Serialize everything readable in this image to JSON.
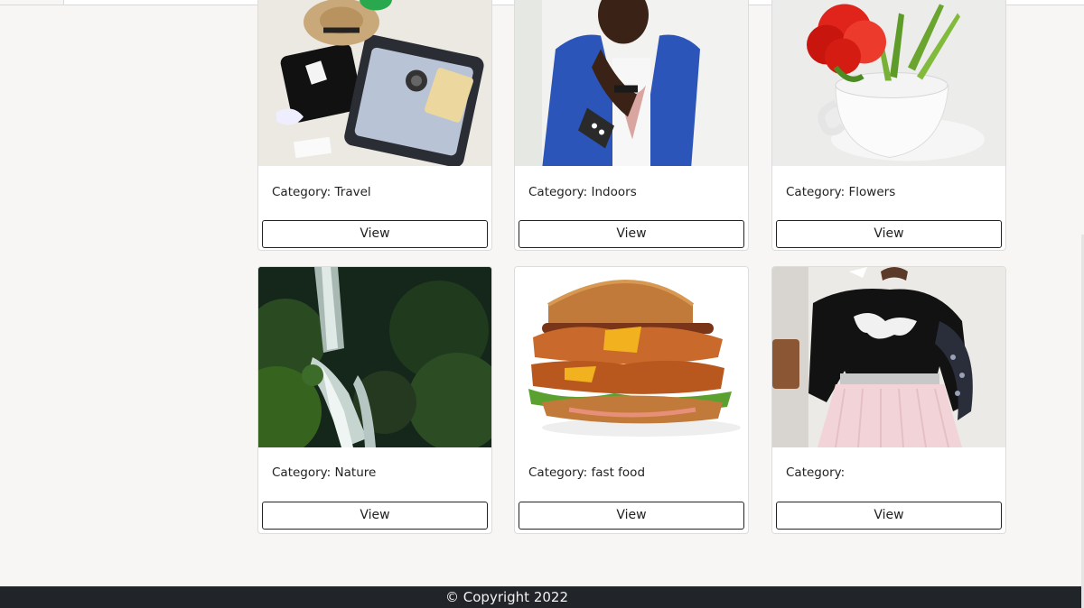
{
  "gallery": {
    "cards": [
      {
        "category_label": "Category: Travel",
        "view_label": "View",
        "image": "travel-suitcase-photo"
      },
      {
        "category_label": "Category: Indoors",
        "view_label": "View",
        "image": "woman-blue-blazer-photo"
      },
      {
        "category_label": "Category: Flowers",
        "view_label": "View",
        "image": "red-tulip-in-cup-photo"
      },
      {
        "category_label": "Category: Nature",
        "view_label": "View",
        "image": "waterfall-forest-photo"
      },
      {
        "category_label": "Category: fast food",
        "view_label": "View",
        "image": "chicken-burger-photo"
      },
      {
        "category_label": "Category:",
        "view_label": "View",
        "image": "pink-skirt-outfit-photo"
      }
    ]
  },
  "footer": {
    "copyright": "© Copyright 2022"
  },
  "colors": {
    "footer_bg": "#212529",
    "page_bg": "#f7f6f4",
    "card_bg": "#ffffff"
  }
}
